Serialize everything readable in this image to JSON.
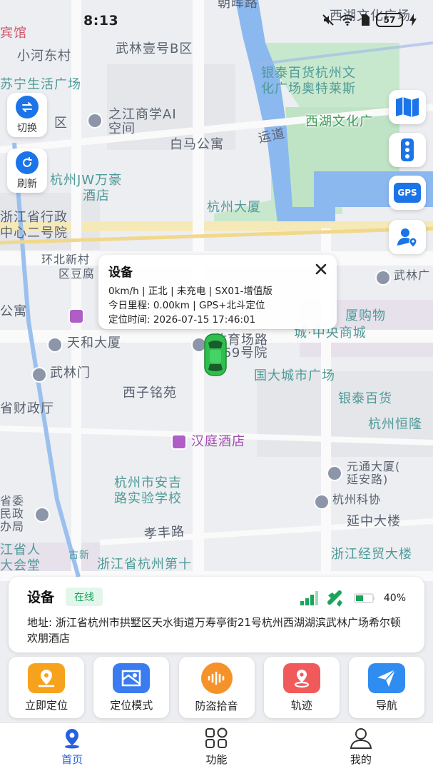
{
  "status_bar": {
    "time": "8:13",
    "battery": "57"
  },
  "map": {
    "labels": [
      {
        "text": "朝晖路",
        "cls": "lbl-dark",
        "rot": 0
      },
      {
        "text": "西湖文化广场",
        "cls": "lbl-dark"
      },
      {
        "text": "宾馆",
        "cls": "lbl-red"
      },
      {
        "text": "小河东村",
        "cls": "lbl-dark"
      },
      {
        "text": "武林壹号B区",
        "cls": "lbl-dark"
      },
      {
        "text": "苏宁生活广场",
        "cls": "lbl-teal"
      },
      {
        "text": "银泰百货杭州文",
        "cls": "lbl-teal"
      },
      {
        "text": "化广场奥特莱斯",
        "cls": "lbl-teal"
      },
      {
        "text": "区",
        "cls": "lbl-dark"
      },
      {
        "text": "之江商学AI",
        "cls": "lbl-dark"
      },
      {
        "text": "空间",
        "cls": "lbl-dark"
      },
      {
        "text": "西湖文化广",
        "cls": "lbl-green"
      },
      {
        "text": "运道",
        "cls": "lbl-dark"
      },
      {
        "text": "白马公寓",
        "cls": "lbl-dark"
      },
      {
        "text": "杭州JW万豪",
        "cls": "lbl-teal"
      },
      {
        "text": "酒店",
        "cls": "lbl-teal"
      },
      {
        "text": "浙江省行政",
        "cls": "lbl-dark"
      },
      {
        "text": "中心二号院",
        "cls": "lbl-dark"
      },
      {
        "text": "杭州大厦",
        "cls": "lbl-teal"
      },
      {
        "text": "环北新村",
        "cls": "lbl-dark"
      },
      {
        "text": "区豆腐",
        "cls": "lbl-dark"
      },
      {
        "text": "武林广",
        "cls": "lbl-dark"
      },
      {
        "text": "公寓",
        "cls": "lbl-dark"
      },
      {
        "text": "厦购物",
        "cls": "lbl-teal"
      },
      {
        "text": "城·中央商城",
        "cls": "lbl-teal"
      },
      {
        "text": "天和大厦",
        "cls": "lbl-dark"
      },
      {
        "text": "体育场路",
        "cls": "lbl-dark"
      },
      {
        "text": "469号院",
        "cls": "lbl-dark"
      },
      {
        "text": "武林门",
        "cls": "lbl-dark"
      },
      {
        "text": "国大城市广场",
        "cls": "lbl-teal"
      },
      {
        "text": "西子铭苑",
        "cls": "lbl-dark"
      },
      {
        "text": "银泰百货",
        "cls": "lbl-teal"
      },
      {
        "text": "省财政厅",
        "cls": "lbl-dark"
      },
      {
        "text": "杭州恒隆",
        "cls": "lbl-teal"
      },
      {
        "text": "汉庭酒店",
        "cls": "lbl-purple"
      },
      {
        "text": "元通大厦(",
        "cls": "lbl-dark"
      },
      {
        "text": "延安路)",
        "cls": "lbl-dark"
      },
      {
        "text": "杭州市安吉",
        "cls": "lbl-teal"
      },
      {
        "text": "路实验学校",
        "cls": "lbl-teal"
      },
      {
        "text": "杭州科协",
        "cls": "lbl-dark"
      },
      {
        "text": "省委",
        "cls": "lbl-dark"
      },
      {
        "text": "民政",
        "cls": "lbl-dark"
      },
      {
        "text": "办局",
        "cls": "lbl-dark"
      },
      {
        "text": "延中大楼",
        "cls": "lbl-dark"
      },
      {
        "text": "孝丰路",
        "cls": "lbl-dark"
      },
      {
        "text": "江省人",
        "cls": "lbl-teal"
      },
      {
        "text": "大会堂",
        "cls": "lbl-teal"
      },
      {
        "text": "浙江经贸大楼",
        "cls": "lbl-teal"
      },
      {
        "text": "浙江省杭州第十",
        "cls": "lbl-teal"
      },
      {
        "text": "古新",
        "cls": "lbl-teal"
      }
    ]
  },
  "controls": {
    "switch_label": "切换",
    "refresh_label": "刷新",
    "gps_label": "GPS"
  },
  "popup": {
    "title": "设备",
    "line1": "0km/h | 正北 | 未充电 | SX01-增值版",
    "line2": "今日里程: 0.00km | GPS+北斗定位",
    "line3": "定位时间: 2026-07-15 17:46:01"
  },
  "device": {
    "name": "设备",
    "status": "在线",
    "battery_pct": "40%",
    "address": "地址: 浙江省杭州市拱墅区天水街道万寿亭街21号杭州西湖湖滨武林广场希尔顿欢朋酒店"
  },
  "actions": [
    {
      "label": "立即定位",
      "color": "#f7a21c",
      "icon": "locate-icon"
    },
    {
      "label": "定位模式",
      "color": "#3a7bf0",
      "icon": "map-mode-icon"
    },
    {
      "label": "防盗拾音",
      "color": "#f5932a",
      "icon": "audio-icon"
    },
    {
      "label": "轨迹",
      "color": "#f05a5a",
      "icon": "track-icon"
    },
    {
      "label": "导航",
      "color": "#2f8cf0",
      "icon": "navigation-icon"
    }
  ],
  "nav": {
    "home": "首页",
    "features": "功能",
    "mine": "我的"
  },
  "colors": {
    "accent": "#2560e0",
    "online": "#1aa35b",
    "water": "#8bb8ef",
    "park": "#bfe3c5"
  }
}
